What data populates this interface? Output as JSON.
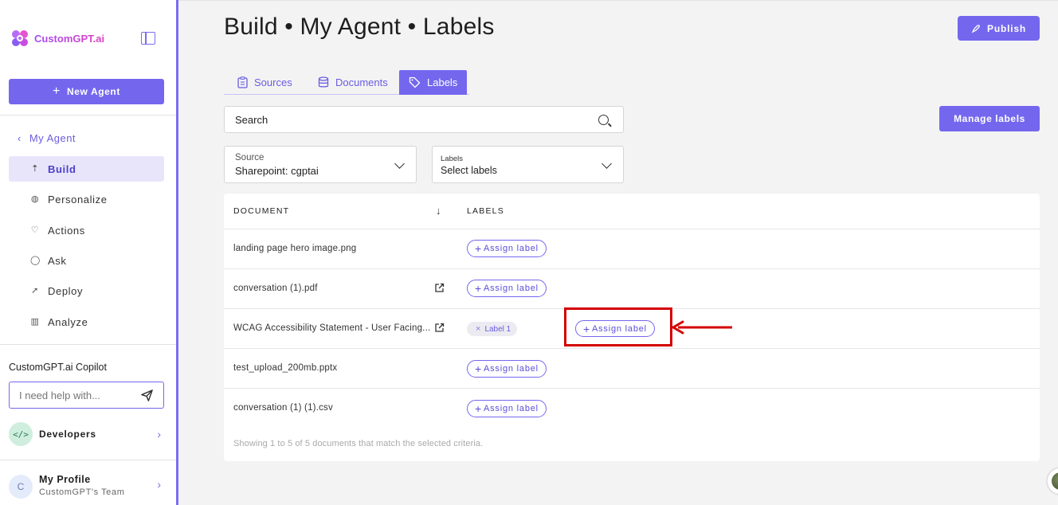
{
  "sidebar": {
    "logo_text": "CustomGPT.ai",
    "new_agent_label": "New Agent",
    "back_label": "My Agent",
    "nav": [
      {
        "label": "Build",
        "icon": "build-icon",
        "active": true
      },
      {
        "label": "Personalize",
        "icon": "palette-icon",
        "active": false
      },
      {
        "label": "Actions",
        "icon": "actions-icon",
        "active": false
      },
      {
        "label": "Ask",
        "icon": "chat-icon",
        "active": false
      },
      {
        "label": "Deploy",
        "icon": "rocket-icon",
        "active": false
      },
      {
        "label": "Analyze",
        "icon": "chart-icon",
        "active": false
      }
    ],
    "copilot_title": "CustomGPT.ai Copilot",
    "copilot_placeholder": "I need help with...",
    "developers_label": "Developers",
    "profile_initial": "C",
    "profile_name": "My Profile",
    "profile_team": "CustomGPT's Team"
  },
  "header": {
    "title": "Build • My Agent • Labels",
    "publish_label": "Publish"
  },
  "tabs": [
    {
      "label": "Sources",
      "icon": "clipboard-icon",
      "active": false
    },
    {
      "label": "Documents",
      "icon": "database-icon",
      "active": false
    },
    {
      "label": "Labels",
      "icon": "tag-icon",
      "active": true
    }
  ],
  "search": {
    "placeholder": "Search"
  },
  "manage_labels_label": "Manage labels",
  "filters": {
    "source_label": "Source",
    "source_value": "Sharepoint: cgptai",
    "labels_label": "Labels",
    "labels_value": "Select labels"
  },
  "table": {
    "col_document": "DOCUMENT",
    "col_labels": "LABELS",
    "sort_icon": "arrow-down-icon",
    "assign_label": "Assign label",
    "rows": [
      {
        "name": "landing page hero image.png",
        "external": false,
        "labels": []
      },
      {
        "name": "conversation (1).pdf",
        "external": true,
        "labels": []
      },
      {
        "name": "WCAG Accessibility Statement - User Facing...",
        "external": true,
        "labels": [
          "Label 1"
        ]
      },
      {
        "name": "test_upload_200mb.pptx",
        "external": false,
        "labels": []
      },
      {
        "name": "conversation (1) (1).csv",
        "external": false,
        "labels": []
      }
    ],
    "footer": "Showing 1 to 5 of 5 documents that match the selected criteria."
  },
  "colors": {
    "accent": "#7467ee",
    "highlight": "#d40000"
  }
}
